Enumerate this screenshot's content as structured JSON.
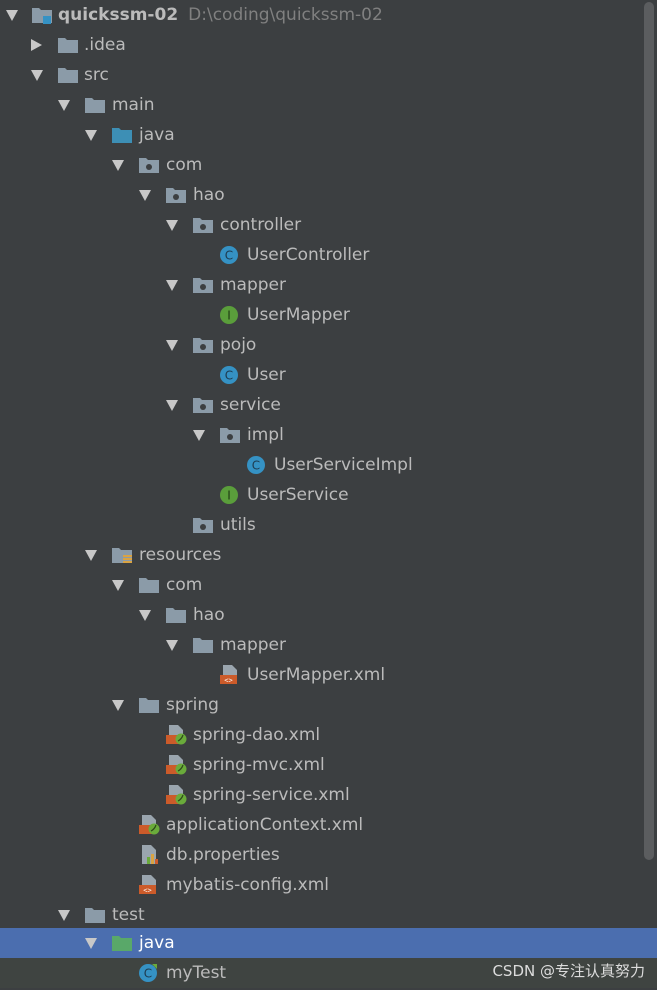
{
  "project": {
    "name": "quickssm-02",
    "path": "D:\\coding\\quickssm-02"
  },
  "tree": {
    "idea": ".idea",
    "src": "src",
    "main": "main",
    "java": "java",
    "com": "com",
    "hao": "hao",
    "controller": "controller",
    "UserController": "UserController",
    "mapper": "mapper",
    "UserMapper": "UserMapper",
    "pojo": "pojo",
    "User": "User",
    "service": "service",
    "impl": "impl",
    "UserServiceImpl": "UserServiceImpl",
    "UserService": "UserService",
    "utils": "utils",
    "resources": "resources",
    "res_com": "com",
    "res_hao": "hao",
    "res_mapper": "mapper",
    "UserMapper_xml": "UserMapper.xml",
    "spring": "spring",
    "spring_dao": "spring-dao.xml",
    "spring_mvc": "spring-mvc.xml",
    "spring_service": "spring-service.xml",
    "applicationContext": "applicationContext.xml",
    "db_properties": "db.properties",
    "mybatis_config": "mybatis-config.xml",
    "test": "test",
    "test_java": "java",
    "myTest": "myTest"
  },
  "watermark": "CSDN @专注认真努力",
  "colors": {
    "background": "#3c3f41",
    "selection": "#4b6eaf",
    "folder": "#8b9ba8",
    "source_folder": "#3d8fb5",
    "test_folder": "#59a869",
    "class_icon": "#3592c4",
    "interface_icon": "#5a9e3b",
    "xml_icon": "#cc5b2a"
  },
  "icons": {
    "module": "module-icon",
    "folder": "folder-icon",
    "package": "package-icon",
    "class": "class-icon",
    "interface": "interface-icon",
    "xml": "xml-file-icon",
    "spring_xml": "spring-xml-icon",
    "properties": "properties-icon",
    "test_class": "test-class-icon"
  }
}
